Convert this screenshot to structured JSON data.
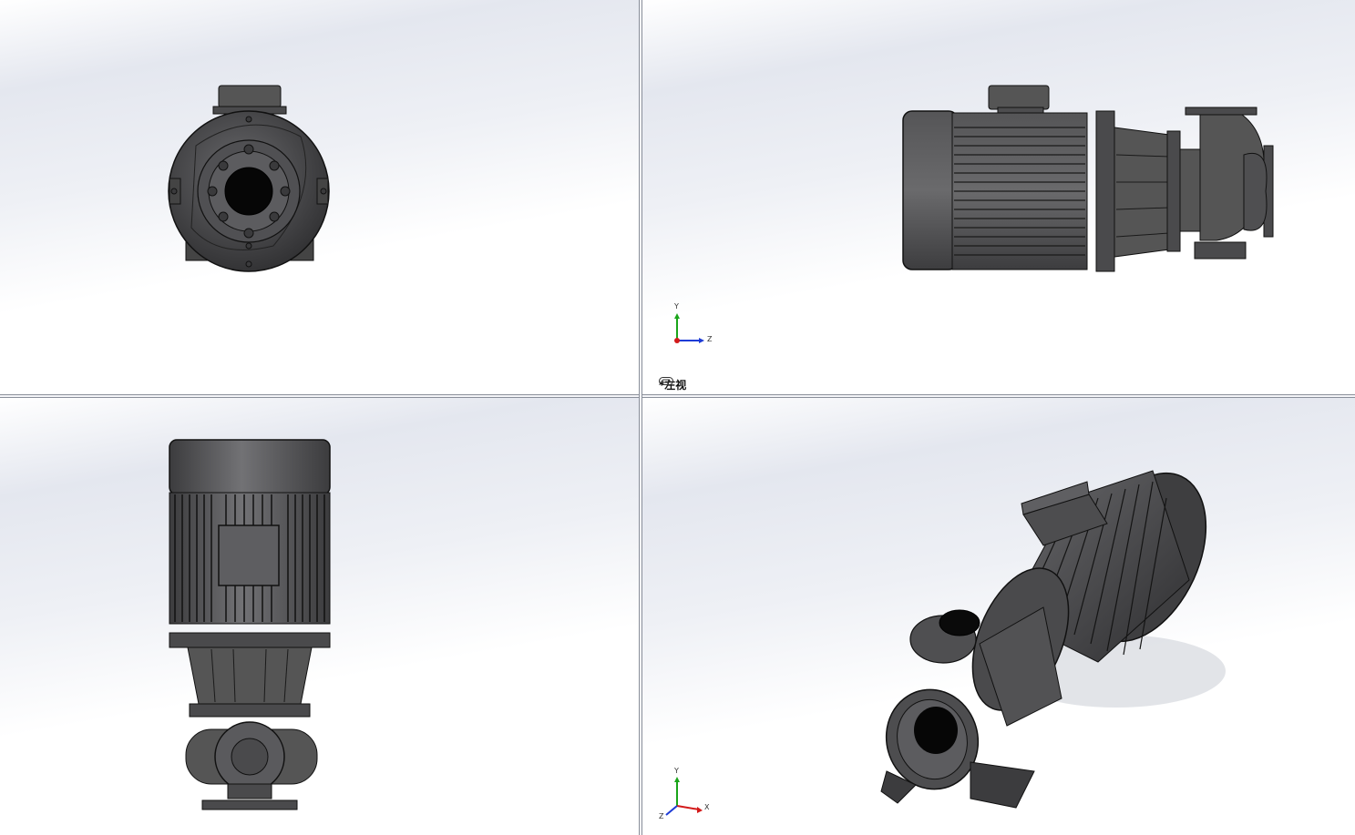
{
  "viewports": {
    "top_left": {
      "name": "front-view"
    },
    "top_right": {
      "name": "left-view",
      "label": "*左视",
      "triad": {
        "y": "Y",
        "z": "Z"
      }
    },
    "bottom_left": {
      "name": "top-view"
    },
    "bottom_right": {
      "name": "isometric-view",
      "triad": {
        "y": "Y",
        "x": "X",
        "z": "Z"
      }
    }
  },
  "colors": {
    "body": "#4a4a4c",
    "dark": "#1a1a1a",
    "edge": "#0c0c0c",
    "light": "#6b6b6e",
    "axis_y": "#1aa51a",
    "axis_z": "#1e3cd6",
    "axis_x": "#d31a1a"
  },
  "icons": {
    "view_link": "link-icon"
  }
}
